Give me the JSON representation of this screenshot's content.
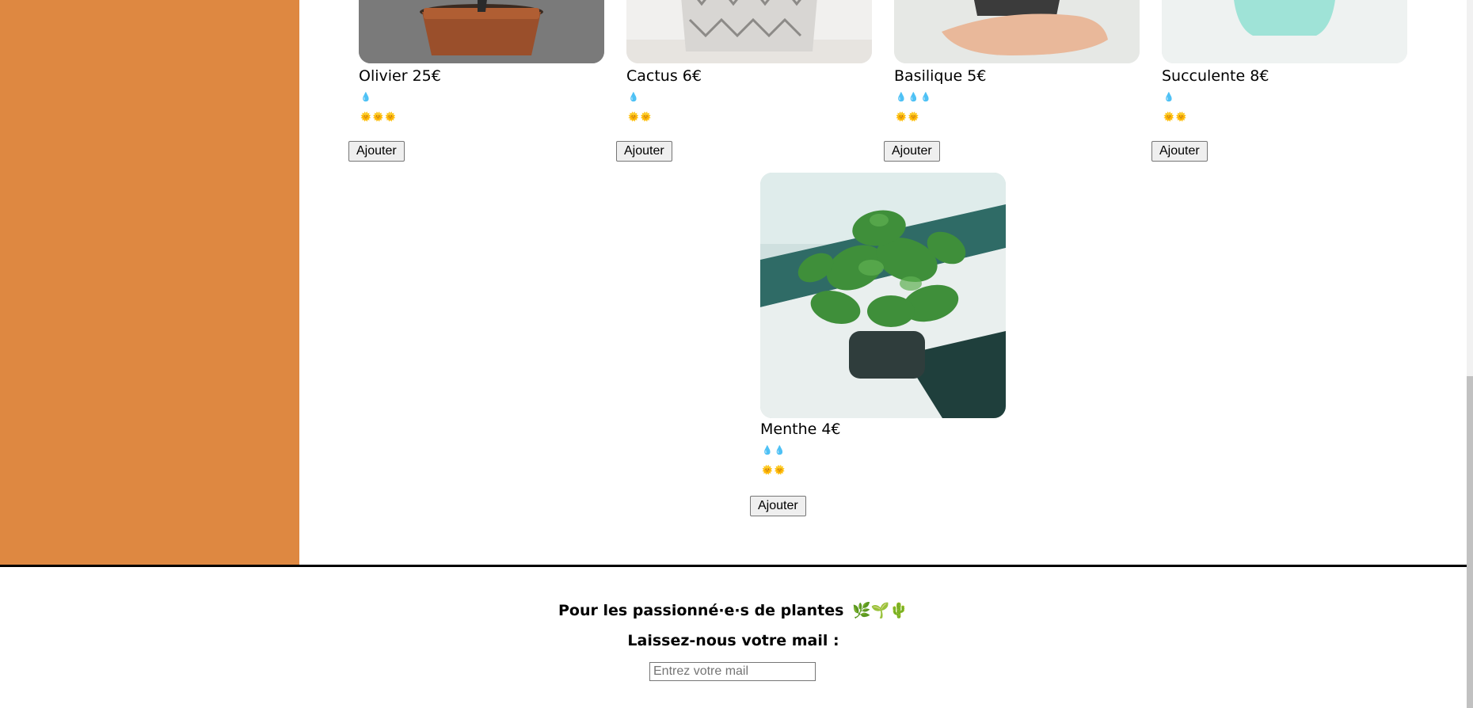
{
  "plants": [
    {
      "name": "Olivier 25€",
      "water": "💧",
      "light": "🌞🌞🌞",
      "button": "Ajouter",
      "photo": "terracotta-pot"
    },
    {
      "name": "Cactus 6€",
      "water": "💧",
      "light": "🌞🌞",
      "button": "Ajouter",
      "photo": "white-patterned-pot"
    },
    {
      "name": "Basilique 5€",
      "water": "💧💧💧",
      "light": "🌞🌞",
      "button": "Ajouter",
      "photo": "hand-holding-pot"
    },
    {
      "name": "Succulente 8€",
      "water": "💧",
      "light": "🌞🌞",
      "button": "Ajouter",
      "photo": "mint-green-pot"
    },
    {
      "name": "Menthe 4€",
      "water": "💧💧",
      "light": "🌞🌞",
      "button": "Ajouter",
      "photo": "mint-plant"
    }
  ],
  "footer": {
    "title": "Pour les passionné·e·s de plantes",
    "title_icons": "🌿🌱🌵",
    "mail_label": "Laissez-nous votre mail :",
    "mail_placeholder": "Entrez votre mail"
  },
  "colors": {
    "sidebar": "#DE8841",
    "divider": "#000000"
  }
}
